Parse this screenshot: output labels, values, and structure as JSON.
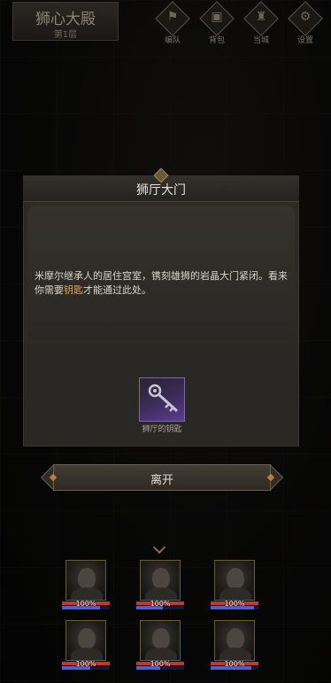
{
  "header": {
    "title": "狮心大殿",
    "floor": "第1层"
  },
  "top_menu": [
    {
      "label": "编队",
      "icon": "banner-icon"
    },
    {
      "label": "背包",
      "icon": "backpack-icon"
    },
    {
      "label": "当城",
      "icon": "castle-icon"
    },
    {
      "label": "设置",
      "icon": "gear-icon"
    }
  ],
  "dialog": {
    "title": "狮厅大门",
    "description_before": "米摩尔继承人的居住宫室，镌刻雄狮的岩晶大门紧闭。看来你需要",
    "description_key": "钥匙",
    "description_after": "才能通过此处。",
    "item_label": "狮厅的钥匙"
  },
  "actions": {
    "leave_label": "离开"
  },
  "party": [
    {
      "hp_text": "100%",
      "hp": 1.0,
      "mp": 0.8
    },
    {
      "hp_text": "100%",
      "hp": 1.0,
      "mp": 0.55
    },
    {
      "hp_text": "100%",
      "hp": 1.0,
      "mp": 0.9
    },
    {
      "hp_text": "100%",
      "hp": 1.0,
      "mp": 0.6
    },
    {
      "hp_text": "100%",
      "hp": 1.0,
      "mp": 0.5
    },
    {
      "hp_text": "100%",
      "hp": 1.0,
      "mp": 0.85
    }
  ],
  "colors": {
    "key_highlight": "#e0a24a",
    "item_rarity": "#5b3c92",
    "hp_bar": "#c0392b",
    "mp_bar": "#4b63d1"
  }
}
